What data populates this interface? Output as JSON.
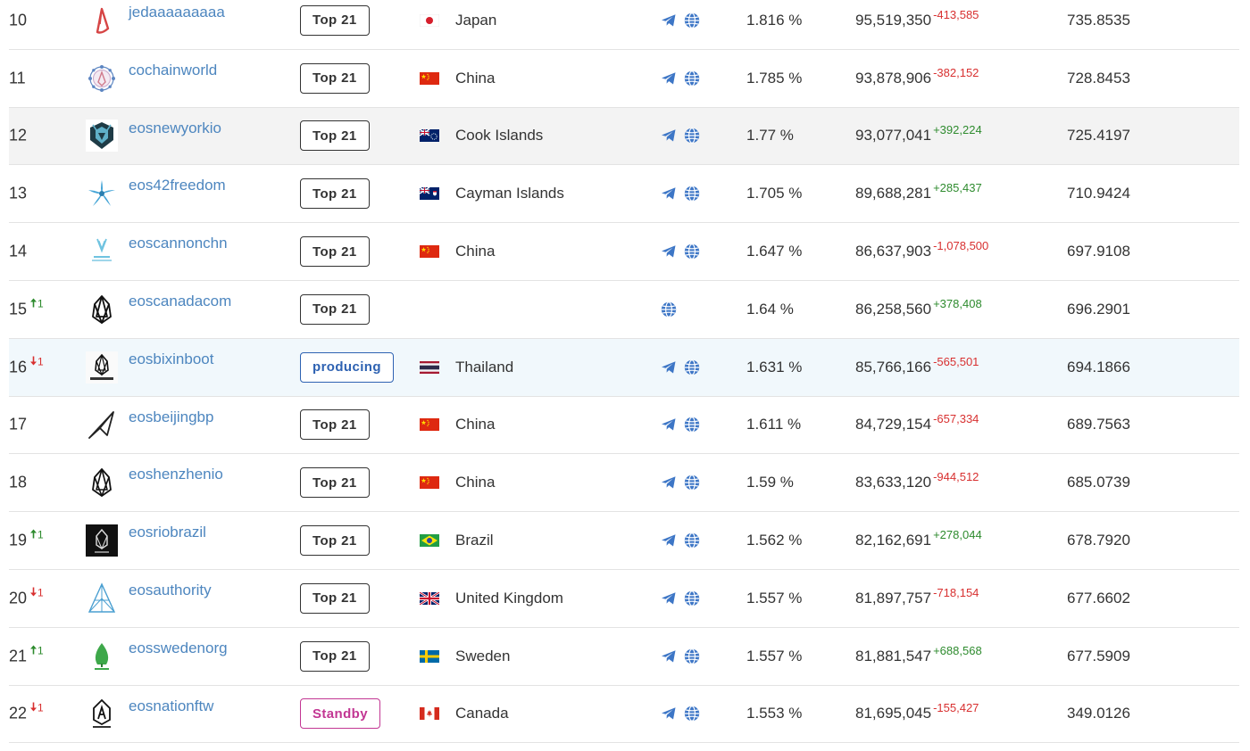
{
  "colors": {
    "link": "#4d86bf",
    "up": "#2e8b2e",
    "down": "#d83030",
    "producing": "#2e62b2",
    "standby": "#c23693",
    "row_highlight_gray": "#f3f3f3",
    "row_highlight_blue": "#f1f8fc"
  },
  "rows": [
    {
      "rank": "10",
      "move": "",
      "move_dir": "",
      "logo": "jedaaaaaaaaa-logo",
      "name": "jedaaaaaaaaa",
      "status": "Top 21",
      "status_kind": "top21",
      "flag": "jp",
      "country": "Japan",
      "links": [
        "telegram",
        "website"
      ],
      "pct": "1.816 %",
      "votes": "95,519,350",
      "delta": "-413,585",
      "delta_dir": "neg",
      "reward": "735.8535",
      "highlight": ""
    },
    {
      "rank": "11",
      "move": "",
      "move_dir": "",
      "logo": "cochainworld-logo",
      "name": "cochainworld",
      "status": "Top 21",
      "status_kind": "top21",
      "flag": "cn",
      "country": "China",
      "links": [
        "telegram",
        "website"
      ],
      "pct": "1.785 %",
      "votes": "93,878,906",
      "delta": "-382,152",
      "delta_dir": "neg",
      "reward": "728.8453",
      "highlight": ""
    },
    {
      "rank": "12",
      "move": "",
      "move_dir": "",
      "logo": "eosnewyorkio-logo",
      "name": "eosnewyorkio",
      "status": "Top 21",
      "status_kind": "top21",
      "flag": "ck",
      "country": "Cook Islands",
      "links": [
        "telegram",
        "website"
      ],
      "pct": "1.77 %",
      "votes": "93,077,041",
      "delta": "+392,224",
      "delta_dir": "pos",
      "reward": "725.4197",
      "highlight": "gray"
    },
    {
      "rank": "13",
      "move": "",
      "move_dir": "",
      "logo": "eos42freedom-logo",
      "name": "eos42freedom",
      "status": "Top 21",
      "status_kind": "top21",
      "flag": "ky",
      "country": "Cayman Islands",
      "links": [
        "telegram",
        "website"
      ],
      "pct": "1.705 %",
      "votes": "89,688,281",
      "delta": "+285,437",
      "delta_dir": "pos",
      "reward": "710.9424",
      "highlight": ""
    },
    {
      "rank": "14",
      "move": "",
      "move_dir": "",
      "logo": "eoscannonchn-logo",
      "name": "eoscannonchn",
      "status": "Top 21",
      "status_kind": "top21",
      "flag": "cn",
      "country": "China",
      "links": [
        "telegram",
        "website"
      ],
      "pct": "1.647 %",
      "votes": "86,637,903",
      "delta": "-1,078,500",
      "delta_dir": "neg",
      "reward": "697.9108",
      "highlight": ""
    },
    {
      "rank": "15",
      "move": "1",
      "move_dir": "up",
      "logo": "eoscanadacom-logo",
      "name": "eoscanadacom",
      "status": "Top 21",
      "status_kind": "top21",
      "flag": "",
      "country": "",
      "links": [
        "website"
      ],
      "pct": "1.64 %",
      "votes": "86,258,560",
      "delta": "+378,408",
      "delta_dir": "pos",
      "reward": "696.2901",
      "highlight": ""
    },
    {
      "rank": "16",
      "move": "1",
      "move_dir": "down",
      "logo": "eosbixinboot-logo",
      "name": "eosbixinboot",
      "status": "producing",
      "status_kind": "producing",
      "flag": "th",
      "country": "Thailand",
      "links": [
        "telegram",
        "website"
      ],
      "pct": "1.631 %",
      "votes": "85,766,166",
      "delta": "-565,501",
      "delta_dir": "neg",
      "reward": "694.1866",
      "highlight": "blue"
    },
    {
      "rank": "17",
      "move": "",
      "move_dir": "",
      "logo": "eosbeijingbp-logo",
      "name": "eosbeijingbp",
      "status": "Top 21",
      "status_kind": "top21",
      "flag": "cn",
      "country": "China",
      "links": [
        "telegram",
        "website"
      ],
      "pct": "1.611 %",
      "votes": "84,729,154",
      "delta": "-657,334",
      "delta_dir": "neg",
      "reward": "689.7563",
      "highlight": ""
    },
    {
      "rank": "18",
      "move": "",
      "move_dir": "",
      "logo": "eoshenzhenio-logo",
      "name": "eoshenzhenio",
      "status": "Top 21",
      "status_kind": "top21",
      "flag": "cn",
      "country": "China",
      "links": [
        "telegram",
        "website"
      ],
      "pct": "1.59 %",
      "votes": "83,633,120",
      "delta": "-944,512",
      "delta_dir": "neg",
      "reward": "685.0739",
      "highlight": ""
    },
    {
      "rank": "19",
      "move": "1",
      "move_dir": "up",
      "logo": "eosriobrazil-logo",
      "name": "eosriobrazil",
      "status": "Top 21",
      "status_kind": "top21",
      "flag": "br",
      "country": "Brazil",
      "links": [
        "telegram",
        "website"
      ],
      "pct": "1.562 %",
      "votes": "82,162,691",
      "delta": "+278,044",
      "delta_dir": "pos",
      "reward": "678.7920",
      "highlight": ""
    },
    {
      "rank": "20",
      "move": "1",
      "move_dir": "down",
      "logo": "eosauthority-logo",
      "name": "eosauthority",
      "status": "Top 21",
      "status_kind": "top21",
      "flag": "gb",
      "country": "United Kingdom",
      "links": [
        "telegram",
        "website"
      ],
      "pct": "1.557 %",
      "votes": "81,897,757",
      "delta": "-718,154",
      "delta_dir": "neg",
      "reward": "677.6602",
      "highlight": ""
    },
    {
      "rank": "21",
      "move": "1",
      "move_dir": "up",
      "logo": "eosswedenorg-logo",
      "name": "eosswedenorg",
      "status": "Top 21",
      "status_kind": "top21",
      "flag": "se",
      "country": "Sweden",
      "links": [
        "telegram",
        "website"
      ],
      "pct": "1.557 %",
      "votes": "81,881,547",
      "delta": "+688,568",
      "delta_dir": "pos",
      "reward": "677.5909",
      "highlight": ""
    },
    {
      "rank": "22",
      "move": "1",
      "move_dir": "down",
      "logo": "eosnationftw-logo",
      "name": "eosnationftw",
      "status": "Standby",
      "status_kind": "standby",
      "flag": "ca",
      "country": "Canada",
      "links": [
        "telegram",
        "website"
      ],
      "pct": "1.553 %",
      "votes": "81,695,045",
      "delta": "-155,427",
      "delta_dir": "neg",
      "reward": "349.0126",
      "highlight": ""
    }
  ]
}
